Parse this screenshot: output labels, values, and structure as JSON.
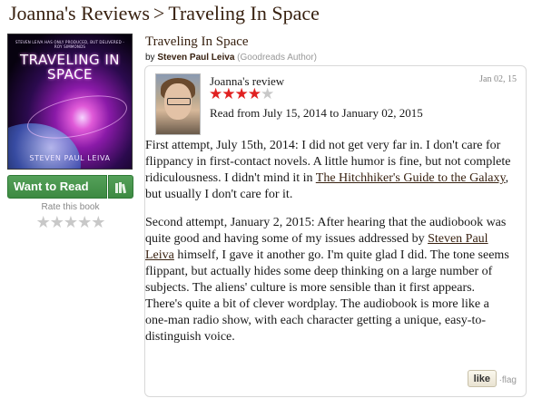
{
  "breadcrumb": {
    "reviewer_link": "Joanna's Reviews",
    "separator": ">",
    "current": "Traveling In Space"
  },
  "cover": {
    "blurb": "STEVEN LEIVA HAS ONLY PRODUCED, BUT DELIVERED - ROY SIMMONDS",
    "title": "TRAVELING IN SPACE",
    "author": "STEVEN PAUL LEIVA"
  },
  "shelf": {
    "want_label": "Want to Read",
    "shelf_icon": "bookshelf-icon",
    "rate_label": "Rate this book",
    "rate_stars": "★★★★★"
  },
  "book": {
    "title": "Traveling In Space",
    "by_prefix": "by",
    "author": "Steven Paul Leiva",
    "author_tag": "(Goodreads Author)"
  },
  "review": {
    "heading": "Joanna's review",
    "date": "Jan 02, 15",
    "rating": 4,
    "max_rating": 5,
    "stars_on": "★★★★",
    "stars_off": "★",
    "read_dates": "Read from July 15, 2014 to January 02, 2015",
    "p1_before": "First attempt, July 15th, 2014: I did not get very far in. I don't care for flippancy in first-contact novels. A little humor is fine, but not complete ridiculousness. I didn't mind it in ",
    "p1_link": "The Hitchhiker's Guide to the Galaxy",
    "p1_after": ", but usually I don't care for it.",
    "p2_before": "Second attempt, January 2, 2015: After hearing that the audiobook was quite good and having some of my issues addressed by ",
    "p2_link": "Steven Paul Leiva",
    "p2_after": " himself, I gave it another go. I'm quite glad I did. The tone seems flippant, but actually hides some deep thinking on a large number of subjects. The aliens' culture is more sensible than it first appears. There's quite a bit of clever wordplay. The audiobook is more like a one-man radio show, with each character getting a unique, easy-to-distinguish voice.",
    "like_label": "like",
    "sep": "·",
    "flag_label": "flag"
  },
  "colors": {
    "link_brown": "#382110",
    "button_green": "#3d8a42",
    "star_red": "#e02020"
  }
}
